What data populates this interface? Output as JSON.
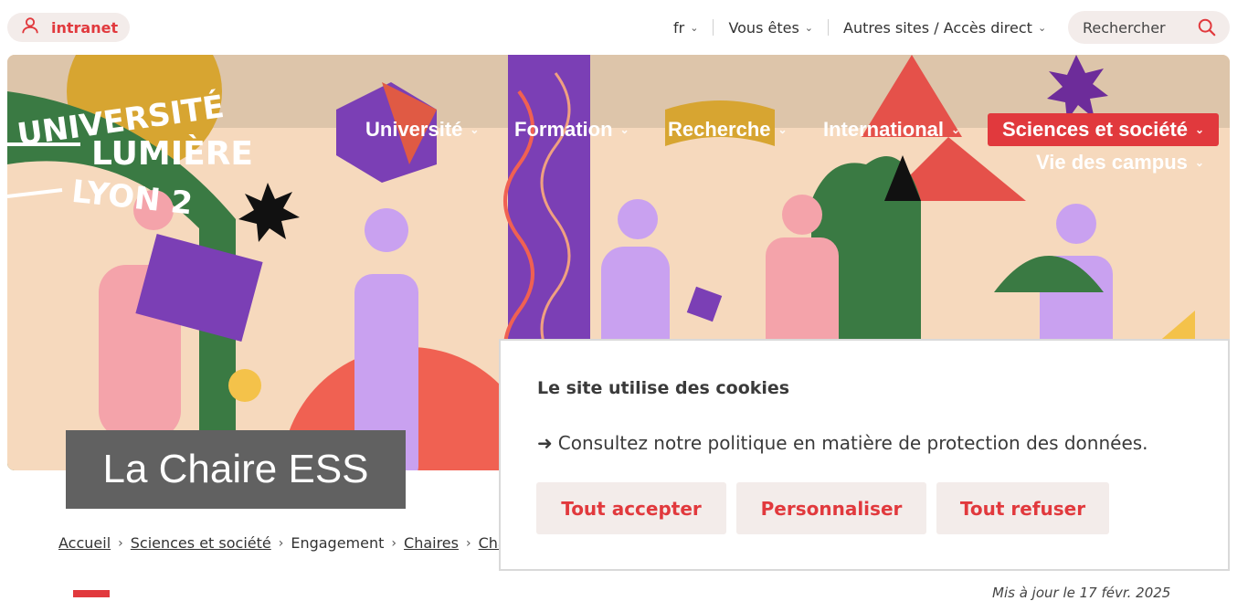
{
  "topbar": {
    "intranet_label": "intranet",
    "lang": "fr",
    "vous_etes": "Vous êtes",
    "autres_sites": "Autres sites / Accès direct",
    "search_placeholder": "Rechercher"
  },
  "logo": {
    "line1": "UNIVERSITÉ",
    "line2": "LUMIÈRE",
    "line3": "LYON 2"
  },
  "nav": {
    "items": [
      {
        "label": "Université"
      },
      {
        "label": "Formation"
      },
      {
        "label": "Recherche"
      },
      {
        "label": "International"
      },
      {
        "label": "Sciences et société"
      },
      {
        "label": "Vie des campus"
      }
    ]
  },
  "page": {
    "title": "La Chaire ESS",
    "date_fragment": "Mis à jour le 17 févr. 2025"
  },
  "breadcrumb": [
    {
      "label": "Accueil"
    },
    {
      "label": "Sciences et société"
    },
    {
      "label": "Engagement"
    },
    {
      "label": "Chaires"
    },
    {
      "label": "Chai"
    }
  ],
  "cookie": {
    "title": "Le site utilise des cookies",
    "arrow": "➜",
    "link_text": "Consultez notre politique en matière de protection des données.",
    "accept": "Tout accepter",
    "customize": "Personnaliser",
    "refuse": "Tout refuser"
  },
  "colors": {
    "accent": "#e1393d",
    "pill_bg": "#f3ecea",
    "title_bg": "#616161"
  }
}
